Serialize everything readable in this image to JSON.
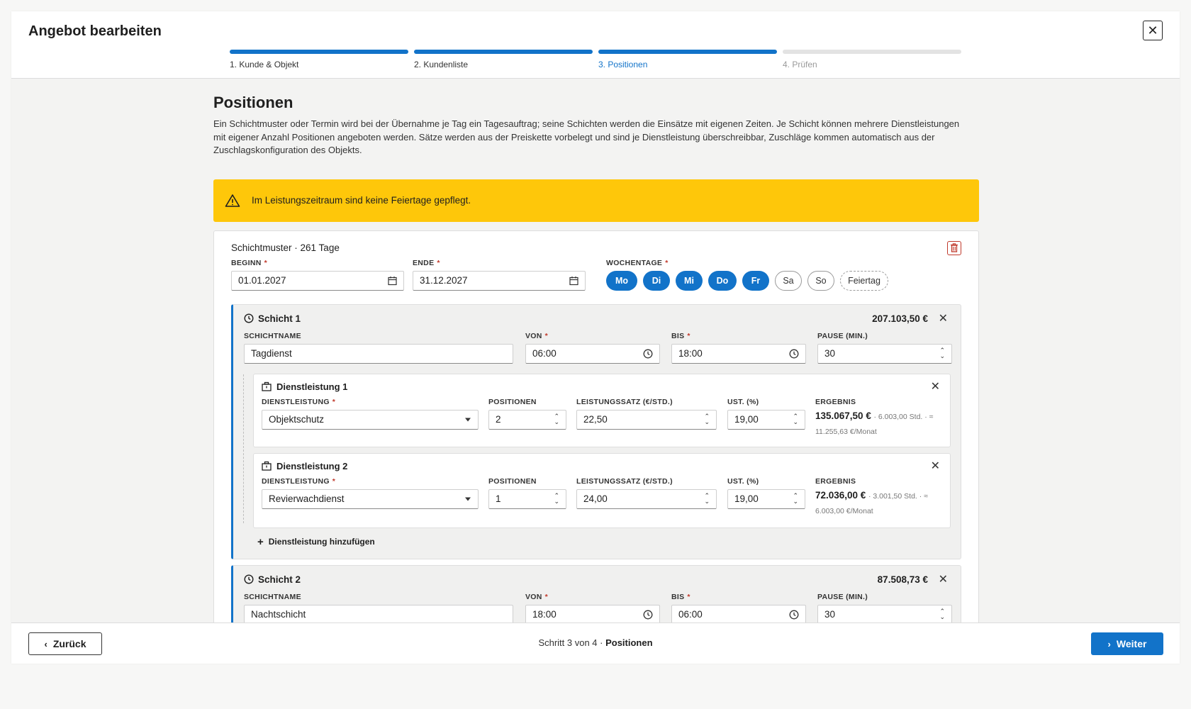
{
  "modal": {
    "title": "Angebot bearbeiten",
    "close_label": "✕"
  },
  "stepper": [
    {
      "label": "1. Kunde & Objekt",
      "state": "done"
    },
    {
      "label": "2. Kundenliste",
      "state": "done"
    },
    {
      "label": "3. Positionen",
      "state": "active"
    },
    {
      "label": "4. Prüfen",
      "state": "todo"
    }
  ],
  "page": {
    "title": "Positionen",
    "description": "Ein Schichtmuster oder Termin wird bei der Übernahme je Tag ein Tagesauftrag; seine Schichten werden die Einsätze mit eigenen Zeiten. Je Schicht können mehrere Dienstleistungen mit eigener Anzahl Positionen angeboten werden. Sätze werden aus der Preiskette vorbelegt und sind je Dienstleistung überschreibbar, Zuschläge kommen automatisch aus der Zuschlagskonfiguration des Objekts."
  },
  "warning": {
    "text": "Im Leistungszeitraum sind keine Feiertage gepflegt.",
    "icon": "warning-triangle-icon"
  },
  "pattern": {
    "title": "Schichtmuster · 261 Tage",
    "begin_label": "BEGINN",
    "begin_value": "01.01.2027",
    "end_label": "ENDE",
    "end_value": "31.12.2027",
    "weekdays_label": "WOCHENTAGE",
    "weekdays": [
      {
        "label": "Mo",
        "selected": true
      },
      {
        "label": "Di",
        "selected": true
      },
      {
        "label": "Mi",
        "selected": true
      },
      {
        "label": "Do",
        "selected": true
      },
      {
        "label": "Fr",
        "selected": true
      },
      {
        "label": "Sa",
        "selected": false
      },
      {
        "label": "So",
        "selected": false
      }
    ],
    "holiday_label": "Feiertag"
  },
  "labels": {
    "shift_name": "SCHICHTNAME",
    "from": "VON",
    "to": "BIS",
    "break": "PAUSE (MIN.)",
    "service": "DIENSTLEISTUNG",
    "positions": "POSITIONEN",
    "rate": "LEISTUNGSSATZ (€/STD.)",
    "vat": "UST. (%)",
    "result": "ERGEBNIS",
    "add_service": "Dienstleistung hinzufügen"
  },
  "shifts": [
    {
      "title": "Schicht 1",
      "total": "207.103,50 €",
      "name": "Tagdienst",
      "from": "06:00",
      "to": "18:00",
      "break": "30",
      "services": [
        {
          "title": "Dienstleistung 1",
          "service": "Objektschutz",
          "positions": "2",
          "rate": "22,50",
          "vat": "19,00",
          "result_main": "135.067,50 €",
          "result_sub1": "· 6.003,00 Std. · ≈",
          "result_sub2": "11.255,63 €/Monat"
        },
        {
          "title": "Dienstleistung 2",
          "service": "Revierwachdienst",
          "positions": "1",
          "rate": "24,00",
          "vat": "19,00",
          "result_main": "72.036,00 €",
          "result_sub1": "· 3.001,50 Std. · ≈",
          "result_sub2": "6.003,00 €/Monat"
        }
      ]
    },
    {
      "title": "Schicht 2",
      "total": "87.508,73 €",
      "name": "Nachtschicht",
      "from": "18:00",
      "to": "06:00",
      "break": "30"
    }
  ],
  "footer": {
    "back_label": "Zurück",
    "next_label": "Weiter",
    "step_text": "Schritt 3 von 4 · ",
    "step_name": "Positionen"
  }
}
